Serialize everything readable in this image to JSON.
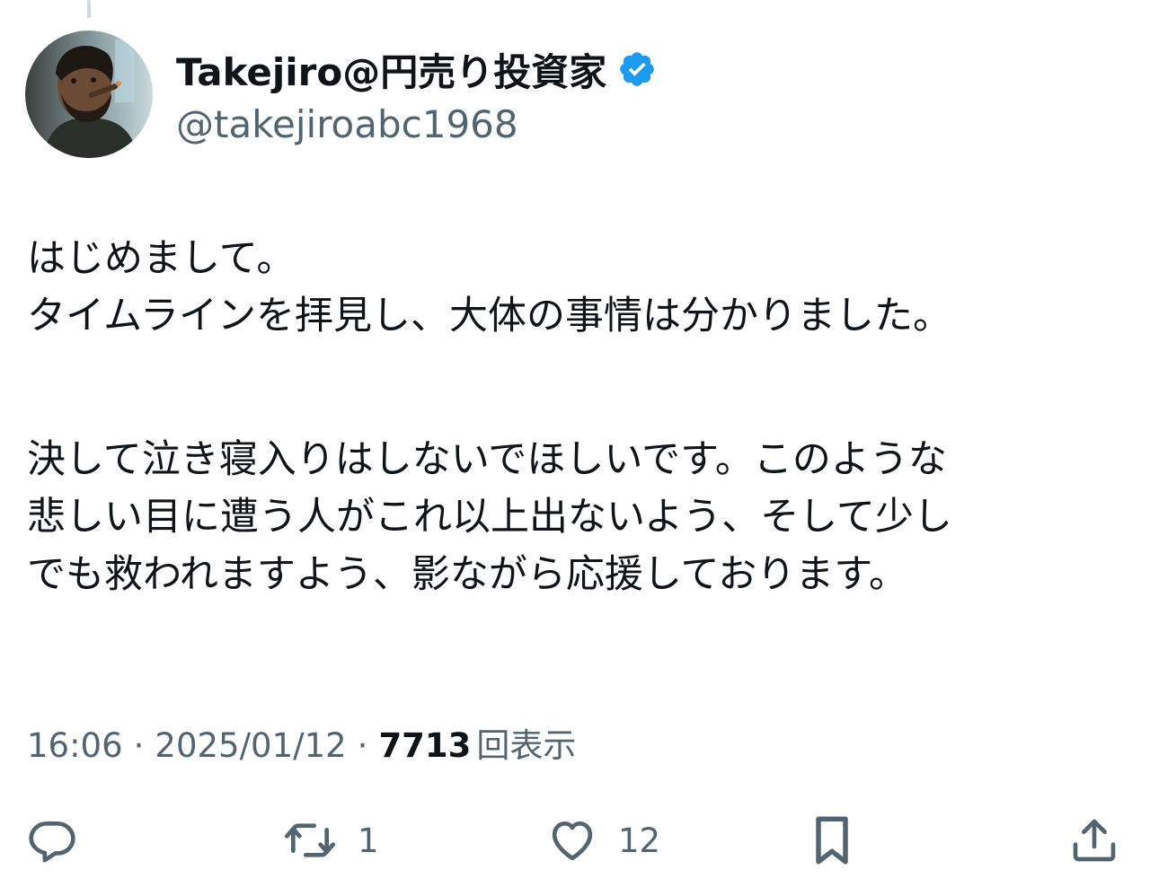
{
  "author": {
    "display_name": "Takejiro@円売り投資家",
    "handle": "@takejiroabc1968",
    "verified_color": "#1d9bf0"
  },
  "tweet": {
    "lines_p1": [
      "はじめまして。",
      "タイムラインを拝見し、大体の事情は分かりました。"
    ],
    "lines_p2": [
      "決して泣き寝入りはしないでほしいです。このような",
      "悲しい目に遭う人がこれ以上出ないよう、そして少し",
      "でも救われますよう、影ながら応援しております。"
    ]
  },
  "meta": {
    "time": "16:06",
    "separator": "·",
    "date": "2025/01/12",
    "views_count": "7713",
    "views_label": "回表示"
  },
  "actions": {
    "reply_icon": "reply-icon",
    "retweet_icon": "retweet-icon",
    "retweet_count": "1",
    "like_icon": "heart-icon",
    "like_count": "12",
    "bookmark_icon": "bookmark-icon",
    "share_icon": "share-icon",
    "icon_color": "#536471"
  }
}
